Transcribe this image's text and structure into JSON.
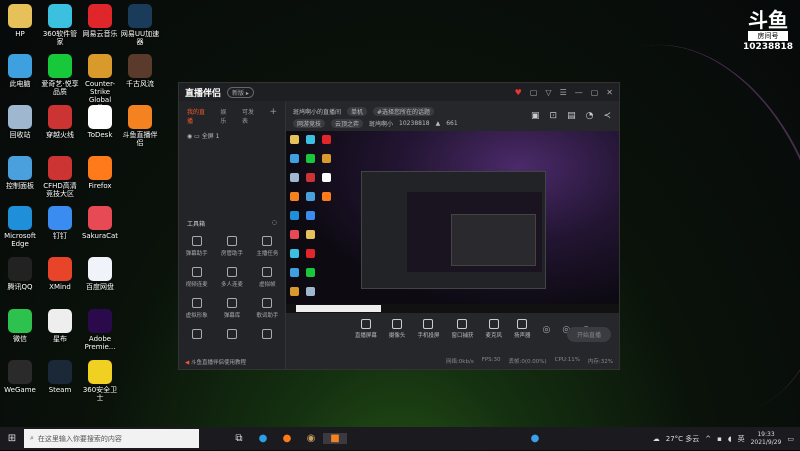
{
  "desktop": {
    "columns": [
      [
        {
          "label": "HP",
          "color": "#e6c15a"
        },
        {
          "label": "此电脑",
          "color": "#3fa0e0"
        },
        {
          "label": "回收站",
          "color": "#9fb8d0"
        },
        {
          "label": "控制面板",
          "color": "#4aa0dc"
        },
        {
          "label": "Microsoft Edge",
          "color": "#1e8fd8"
        },
        {
          "label": "腾讯QQ",
          "color": "#222"
        },
        {
          "label": "微信",
          "color": "#2dc24d"
        },
        {
          "label": "WeGame",
          "color": "#2a2a2a"
        }
      ],
      [
        {
          "label": "360软件管家",
          "color": "#3cc0e0"
        },
        {
          "label": "爱奇艺·悦享品质",
          "color": "#17c93a"
        },
        {
          "label": "穿越火线",
          "color": "#c33"
        },
        {
          "label": "CFHD高清竞技大区",
          "color": "#c33"
        },
        {
          "label": "钉钉",
          "color": "#3b8cf0"
        },
        {
          "label": "XMind",
          "color": "#e8442a"
        },
        {
          "label": "星布",
          "color": "#eee"
        },
        {
          "label": "Steam",
          "color": "#1b2838"
        }
      ],
      [
        {
          "label": "网易云音乐",
          "color": "#e0262b"
        },
        {
          "label": "Counter-Strike Global Off...",
          "color": "#d99a2b"
        },
        {
          "label": "ToDesk",
          "color": "#fff"
        },
        {
          "label": "Firefox",
          "color": "#ff7a1a"
        },
        {
          "label": "SakuraCat",
          "color": "#e84a55"
        },
        {
          "label": "百度网盘",
          "color": "#f0f4fa"
        },
        {
          "label": "Adobe Premie...",
          "color": "#2a0a4a"
        },
        {
          "label": "360安全卫士",
          "color": "#f0d020"
        }
      ],
      [
        {
          "label": "网易UU加速器",
          "color": "#1b3b5a"
        },
        {
          "label": "千古风流",
          "color": "#5a3a2a"
        },
        {
          "label": "斗鱼直播伴侣",
          "color": "#f58220"
        }
      ]
    ]
  },
  "watermark": {
    "brand": "斗鱼",
    "sub": "房间号",
    "room": "10238818"
  },
  "app": {
    "title": "直播伴侣",
    "version_pill": "新版 ▸",
    "window_buttons": [
      "♥",
      "▢",
      "▽",
      "☰",
      "—",
      "▢",
      "✕"
    ],
    "tabs": [
      "我的直播",
      "娱乐",
      "可发表"
    ],
    "add": "+",
    "scene": "全屏 1",
    "room_title": "斑鸠啊小的直播间",
    "tag_category": "单机",
    "tag_topic": "#选择您所在的话题",
    "tag_area": "网游竞技",
    "tag_game": "云顶之弈",
    "streamer": "斑鸠啊小",
    "room_id": "10238818",
    "popularity": "661",
    "tools_title": "工具箱",
    "tools": [
      "弹幕助手",
      "房管助手",
      "主播任务",
      "视频连麦",
      "多人连麦",
      "虚拟帧",
      "虚拟形象",
      "弹幕库",
      "歌词助手",
      "",
      "",
      ""
    ],
    "notice": "斗鱼直播伴侣使用教程",
    "controls": [
      "直播屏幕",
      "摄像头",
      "手机投屏",
      "窗口捕获",
      "麦克风",
      "扬声器"
    ],
    "start_live": "开始直播",
    "status": {
      "network": "网络:0kb/s",
      "fps": "FPS:30",
      "dropped": "丢帧:0(0.00%)",
      "cpu": "CPU:11%",
      "memory": "内存:32%"
    }
  },
  "taskbar": {
    "search_placeholder": "在这里输入你要搜索的内容",
    "weather": "27°C 多云",
    "time": "19:33",
    "date": "2021/9/29",
    "ime": "英"
  }
}
